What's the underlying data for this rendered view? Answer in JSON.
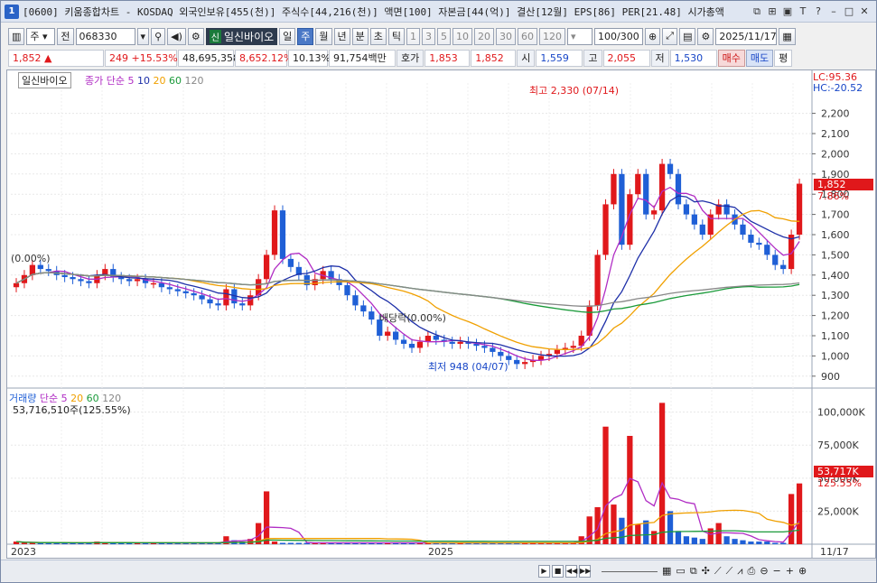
{
  "title": {
    "number": "1",
    "text": "[0600] 키움종합차트 - KOSDAQ 외국인보유[455(천)] 주식수[44,216(천)] 액면[100] 자본금[44(억)] 결산[12월] EPS[86] PER[21.48] 시가총액"
  },
  "toolbar": {
    "type1": "주",
    "type2": "전",
    "code": "068330",
    "stock_tag": "신",
    "stock_name": "일신바이오",
    "periods": [
      "일",
      "주",
      "월",
      "년",
      "분",
      "초",
      "틱"
    ],
    "active_period": "주",
    "intervals": [
      "1",
      "3",
      "5",
      "10",
      "20",
      "30",
      "60",
      "120"
    ],
    "count": "100/300",
    "date": "2025/11/17"
  },
  "price_bar": {
    "price": "1,852",
    "change": "249",
    "rate": "+15.53%",
    "volume": "48,695,358",
    "vol_rate": "8,652.12%",
    "turnover": "10.13%",
    "amount": "91,754백만",
    "quote_label": "호가",
    "ask": "1,853",
    "bid": "1,852",
    "open_label": "시",
    "open": "1,559",
    "high_label": "고",
    "high": "2,055",
    "low_label": "저",
    "low": "1,530",
    "buy": "매수",
    "sell": "매도",
    "eval": "평"
  },
  "chart_legend": {
    "stock": "일신바이오",
    "ma_label": "종가 단순",
    "ma_periods": [
      "5",
      "10",
      "20",
      "60",
      "120"
    ],
    "volume_label": "거래량",
    "vol_ma_label": "단순",
    "vol_ma_periods": [
      "5",
      "20",
      "60",
      "120"
    ],
    "volume_value": "53,716,510주(125.55%)"
  },
  "chart_labels": {
    "lc": "LC:95.36",
    "hc": "HC:-20.52",
    "high_note": "최고 2,330 (07/14)",
    "low_note": "최저 948 (04/07)",
    "dividend_note": "배당락(0.00%)",
    "left_note": "(0.00%)",
    "price_tag": "1,852",
    "price_pct": "7.86%",
    "vol_tag": "53,717K",
    "vol_pct": "125.55%",
    "x_labels": [
      "2023",
      "2025"
    ],
    "date_label": "11/17"
  },
  "colors": {
    "up": "#e0181b",
    "down": "#1f5fd6",
    "ma5": "#b02cc4",
    "ma10": "#1d2fa8",
    "ma20": "#f0a000",
    "ma60": "#1a9a3a",
    "ma120": "#888888"
  },
  "chart_data": {
    "type": "candlestick",
    "price_axis": [
      "2,200",
      "2,100",
      "2,000",
      "1,900",
      "1,800",
      "1,700",
      "1,600",
      "1,500",
      "1,400",
      "1,300",
      "1,200",
      "1,100",
      "1,000",
      "900"
    ],
    "price_ticks": [
      2200,
      2100,
      2000,
      1900,
      1800,
      1700,
      1600,
      1500,
      1400,
      1300,
      1200,
      1100,
      1000,
      900
    ],
    "volume_axis": [
      "100,000K",
      "75,000K",
      "50,000K",
      "25,000K"
    ],
    "volume_ticks": [
      100000,
      75000,
      50000,
      25000
    ],
    "close_series": [
      1360,
      1400,
      1450,
      1430,
      1420,
      1400,
      1390,
      1380,
      1370,
      1360,
      1400,
      1430,
      1390,
      1380,
      1370,
      1380,
      1360,
      1360,
      1340,
      1330,
      1320,
      1310,
      1300,
      1280,
      1260,
      1250,
      1330,
      1260,
      1250,
      1300,
      1380,
      1500,
      1720,
      1480,
      1440,
      1400,
      1350,
      1380,
      1420,
      1380,
      1350,
      1300,
      1250,
      1220,
      1180,
      1100,
      1120,
      1080,
      1060,
      1040,
      1070,
      1100,
      1080,
      1070,
      1060,
      1070,
      1060,
      1050,
      1040,
      1020,
      1000,
      980,
      960,
      970,
      980,
      1000,
      1010,
      1030,
      1040,
      1050,
      1100,
      1250,
      1500,
      1750,
      1900,
      1550,
      1800,
      1900,
      1700,
      1720,
      1950,
      1900,
      1750,
      1700,
      1650,
      1600,
      1700,
      1750,
      1700,
      1650,
      1600,
      1560,
      1550,
      1500,
      1450,
      1430,
      1600,
      1852
    ],
    "open_series": [
      1340,
      1360,
      1400,
      1450,
      1430,
      1420,
      1400,
      1390,
      1380,
      1370,
      1360,
      1400,
      1430,
      1390,
      1380,
      1370,
      1380,
      1360,
      1360,
      1340,
      1330,
      1320,
      1310,
      1300,
      1280,
      1260,
      1250,
      1330,
      1260,
      1250,
      1300,
      1380,
      1500,
      1720,
      1480,
      1440,
      1400,
      1350,
      1380,
      1420,
      1380,
      1350,
      1300,
      1250,
      1220,
      1180,
      1100,
      1120,
      1080,
      1060,
      1040,
      1070,
      1100,
      1080,
      1070,
      1060,
      1070,
      1060,
      1050,
      1040,
      1020,
      1000,
      980,
      960,
      970,
      980,
      1000,
      1010,
      1030,
      1040,
      1050,
      1100,
      1250,
      1500,
      1750,
      1900,
      1550,
      1800,
      1900,
      1700,
      1720,
      1950,
      1900,
      1750,
      1700,
      1650,
      1600,
      1700,
      1750,
      1700,
      1650,
      1600,
      1560,
      1550,
      1500,
      1450,
      1430,
      1600
    ],
    "volume_series": [
      2,
      1,
      1,
      1,
      1,
      1,
      1,
      1,
      1,
      1,
      2,
      1,
      1,
      1,
      1,
      1,
      1,
      1,
      1,
      1,
      1,
      1,
      1,
      1,
      1,
      1,
      6,
      3,
      2,
      4,
      16,
      40,
      2,
      1,
      1,
      1,
      1,
      1,
      1,
      1,
      1,
      1,
      1,
      1,
      1,
      1,
      1,
      1,
      1,
      1,
      1,
      1,
      1,
      1,
      1,
      1,
      1,
      1,
      1,
      1,
      1,
      1,
      1,
      1,
      1,
      1,
      1,
      1,
      1,
      1,
      6,
      21,
      28,
      89,
      30,
      20,
      82,
      15,
      18,
      10,
      107,
      25,
      10,
      6,
      5,
      4,
      12,
      16,
      6,
      4,
      3,
      2,
      2,
      2,
      1,
      1,
      38,
      46
    ]
  }
}
